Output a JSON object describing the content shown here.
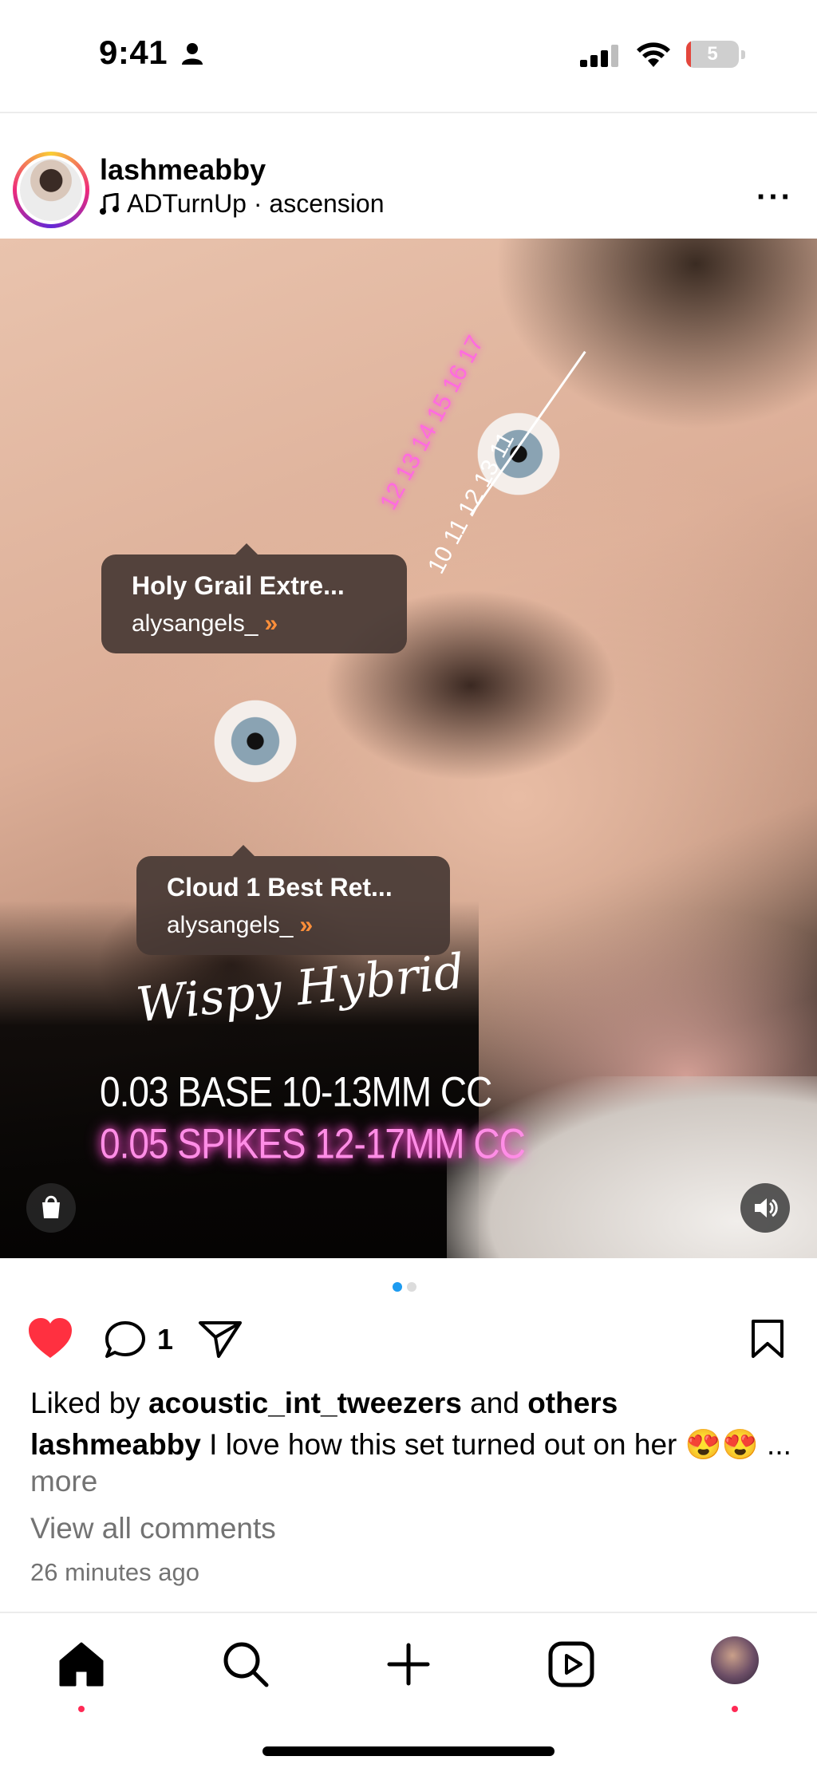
{
  "status_bar": {
    "time": "9:41",
    "battery_level": "5",
    "battery_fraction": 0.05
  },
  "post": {
    "username": "lashmeabby",
    "audio": "ADTurnUp · ascension",
    "more_icon": "ellipsis-icon",
    "product_tags": [
      {
        "title": "Holy Grail Extre...",
        "shop": "alysangels_"
      },
      {
        "title": "Cloud 1 Best Ret...",
        "shop": "alysangels_"
      }
    ],
    "overlay": {
      "script_title": "Wispy Hybrid",
      "line1": "0.03 BASE 10-13MM CC",
      "line2": "0.05 SPIKES 12-17MM CC",
      "pink_lengths": "12 13 14 15 16 17",
      "white_lengths": "10  11  12  13  11"
    },
    "carousel": {
      "count": 2,
      "active": 0
    },
    "comment_count": "1",
    "likes_prefix": "Liked by ",
    "likes_user": "acoustic_int_tweezers",
    "likes_mid": " and ",
    "likes_suffix": "others",
    "caption_user": "lashmeabby",
    "caption_text": " I love how this set turned out on her 😍😍",
    "caption_more_ellipsis": "... ",
    "caption_more": "more",
    "view_comments": "View all comments",
    "time_ago": "26 minutes ago"
  },
  "colors": {
    "like_red": "#ff3040",
    "accent_blue": "#1d9bf0",
    "muted_text": "#737373",
    "overlay_pink": "#ff8de6"
  },
  "tabbar": {
    "items": [
      "home-icon",
      "search-icon",
      "create-icon",
      "reels-icon",
      "profile-avatar"
    ]
  }
}
